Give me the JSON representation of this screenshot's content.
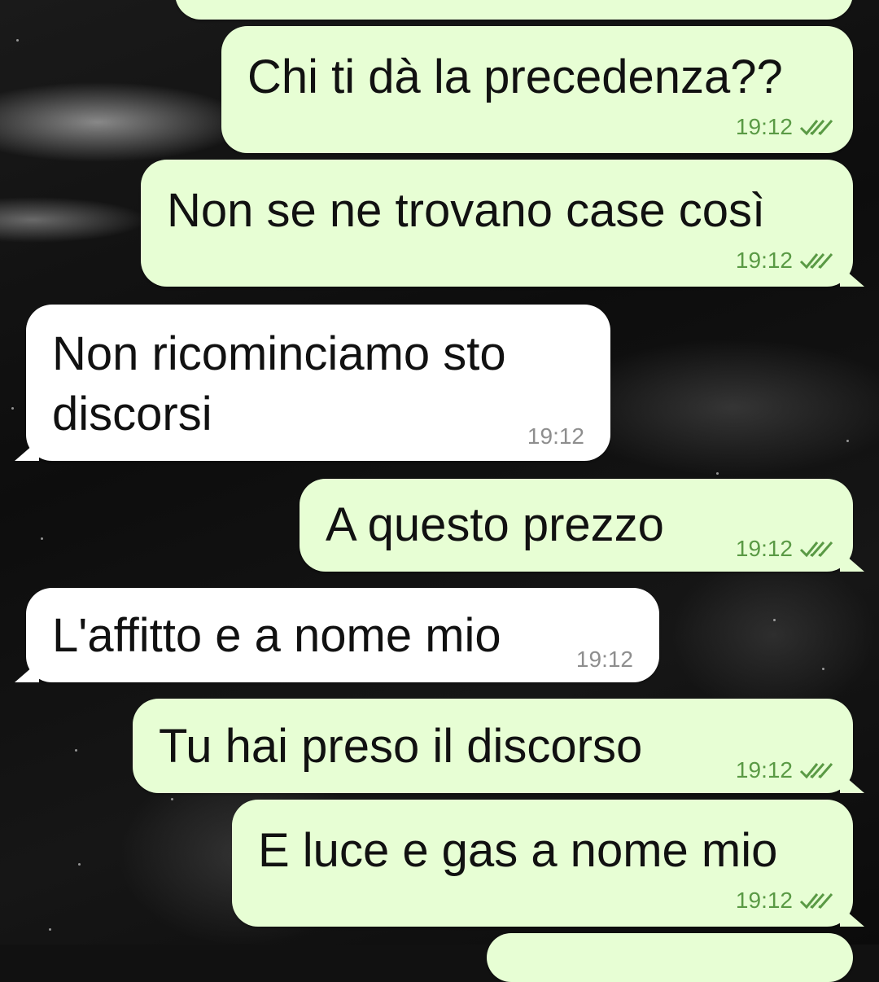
{
  "wallpaper": {
    "description": ""
  },
  "colors": {
    "outgoing_bubble": "#e7fed4",
    "incoming_bubble": "#ffffff",
    "read_ticks": "#5a9a45",
    "time_incoming": "#8e8e8e"
  },
  "messages": [
    {
      "direction": "outgoing",
      "text": "Chi ti dà la precedenza??",
      "time": "19:12",
      "status": "read-double-check-icon"
    },
    {
      "direction": "outgoing",
      "text": "Non se ne trovano case così",
      "time": "19:12",
      "status": "read-double-check-icon"
    },
    {
      "direction": "incoming",
      "text_line1": "Non ricominciamo sto",
      "text_line2": "discorsi",
      "time": "19:12"
    },
    {
      "direction": "outgoing",
      "text": "A questo prezzo",
      "time": "19:12",
      "status": "read-double-check-icon"
    },
    {
      "direction": "incoming",
      "text": "L'affitto e a nome mio",
      "time": "19:12"
    },
    {
      "direction": "outgoing",
      "text": "Tu hai preso il discorso",
      "time": "19:12",
      "status": "read-double-check-icon"
    },
    {
      "direction": "outgoing",
      "text": "E luce e gas a nome mio",
      "time": "19:12",
      "status": "read-double-check-icon"
    }
  ]
}
